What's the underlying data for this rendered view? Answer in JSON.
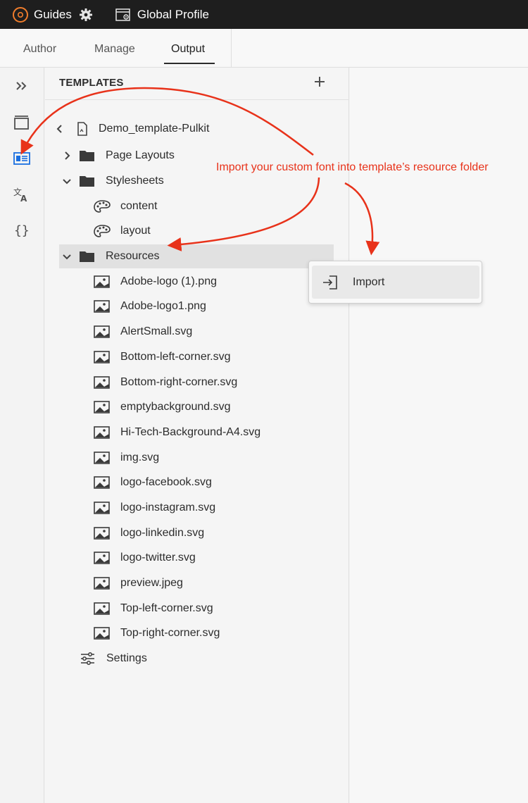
{
  "topbar": {
    "app_name": "Guides",
    "profile_label": "Global Profile",
    "icons": [
      "app-logo-icon",
      "gear-icon",
      "global-profile-icon"
    ]
  },
  "tabs": [
    {
      "label": "Author",
      "active": false
    },
    {
      "label": "Manage",
      "active": false
    },
    {
      "label": "Output",
      "active": true
    }
  ],
  "rail": {
    "icons": [
      "expand-panel-icon",
      "presets-icon",
      "templates-icon",
      "translation-icon",
      "json-braces-icon"
    ],
    "active_icon": "templates-icon",
    "active_color": "#1a6fe0"
  },
  "templates": {
    "title": "TEMPLATES",
    "root": "Demo_template-Pulkit",
    "page_layouts": "Page Layouts",
    "stylesheets": "Stylesheets",
    "stylesheet_items": [
      "content",
      "layout"
    ],
    "resources": "Resources",
    "resource_items": [
      "Adobe-logo (1).png",
      "Adobe-logo1.png",
      "AlertSmall.svg",
      "Bottom-left-corner.svg",
      "Bottom-right-corner.svg",
      "emptybackground.svg",
      "Hi-Tech-Background-A4.svg",
      "img.svg",
      "logo-facebook.svg",
      "logo-instagram.svg",
      "logo-linkedin.svg",
      "logo-twitter.svg",
      "preview.jpeg",
      "Top-left-corner.svg",
      "Top-right-corner.svg"
    ],
    "settings": "Settings"
  },
  "context_menu": {
    "import_label": "Import"
  },
  "annotation": {
    "text": "Import your custom font into template’s resource folder",
    "color": "#e8321a"
  }
}
